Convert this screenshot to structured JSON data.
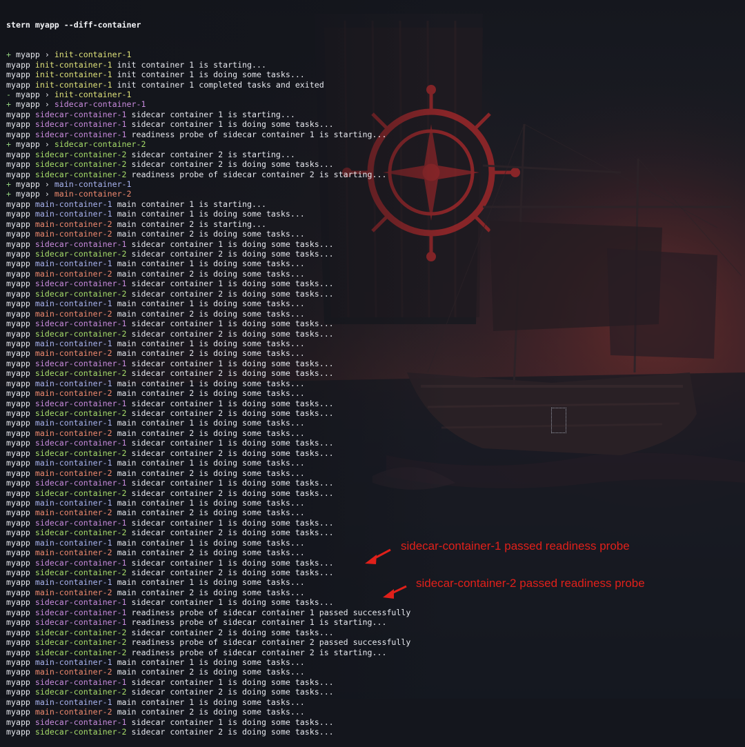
{
  "colors": {
    "prefix_plus": "#92d17d",
    "prefix_minus": "#92d17d",
    "pod": "#e6e8ee",
    "message": "#e6e8ee",
    "annotation": "#e0201a",
    "containers": {
      "init-container-1": "#dfe27a",
      "sidecar-container-1": "#c98bde",
      "sidecar-container-2": "#a7dd6a",
      "main-container-1": "#a9b4f0",
      "main-container-2": "#f08a6f"
    }
  },
  "command": "stern myapp --diff-container",
  "lines": [
    {
      "kind": "event",
      "prefix": "+",
      "pod": "myapp",
      "sep": "›",
      "container": "init-container-1"
    },
    {
      "kind": "log",
      "pod": "myapp",
      "container": "init-container-1",
      "message": "init container 1 is starting..."
    },
    {
      "kind": "log",
      "pod": "myapp",
      "container": "init-container-1",
      "message": "init container 1 is doing some tasks..."
    },
    {
      "kind": "log",
      "pod": "myapp",
      "container": "init-container-1",
      "message": "init container 1 completed tasks and exited"
    },
    {
      "kind": "event",
      "prefix": "-",
      "pod": "myapp",
      "sep": "›",
      "container": "init-container-1"
    },
    {
      "kind": "event",
      "prefix": "+",
      "pod": "myapp",
      "sep": "›",
      "container": "sidecar-container-1"
    },
    {
      "kind": "log",
      "pod": "myapp",
      "container": "sidecar-container-1",
      "message": "sidecar container 1 is starting..."
    },
    {
      "kind": "log",
      "pod": "myapp",
      "container": "sidecar-container-1",
      "message": "sidecar container 1 is doing some tasks..."
    },
    {
      "kind": "log",
      "pod": "myapp",
      "container": "sidecar-container-1",
      "message": "readiness probe of sidecar container 1 is starting..."
    },
    {
      "kind": "event",
      "prefix": "+",
      "pod": "myapp",
      "sep": "›",
      "container": "sidecar-container-2"
    },
    {
      "kind": "log",
      "pod": "myapp",
      "container": "sidecar-container-2",
      "message": "sidecar container 2 is starting..."
    },
    {
      "kind": "log",
      "pod": "myapp",
      "container": "sidecar-container-2",
      "message": "sidecar container 2 is doing some tasks..."
    },
    {
      "kind": "log",
      "pod": "myapp",
      "container": "sidecar-container-2",
      "message": "readiness probe of sidecar container 2 is starting..."
    },
    {
      "kind": "event",
      "prefix": "+",
      "pod": "myapp",
      "sep": "›",
      "container": "main-container-1"
    },
    {
      "kind": "event",
      "prefix": "+",
      "pod": "myapp",
      "sep": "›",
      "container": "main-container-2"
    },
    {
      "kind": "log",
      "pod": "myapp",
      "container": "main-container-1",
      "message": "main container 1 is starting..."
    },
    {
      "kind": "log",
      "pod": "myapp",
      "container": "main-container-1",
      "message": "main container 1 is doing some tasks..."
    },
    {
      "kind": "log",
      "pod": "myapp",
      "container": "main-container-2",
      "message": "main container 2 is starting..."
    },
    {
      "kind": "log",
      "pod": "myapp",
      "container": "main-container-2",
      "message": "main container 2 is doing some tasks..."
    },
    {
      "kind": "log",
      "pod": "myapp",
      "container": "sidecar-container-1",
      "message": "sidecar container 1 is doing some tasks..."
    },
    {
      "kind": "log",
      "pod": "myapp",
      "container": "sidecar-container-2",
      "message": "sidecar container 2 is doing some tasks..."
    },
    {
      "kind": "log",
      "pod": "myapp",
      "container": "main-container-1",
      "message": "main container 1 is doing some tasks..."
    },
    {
      "kind": "log",
      "pod": "myapp",
      "container": "main-container-2",
      "message": "main container 2 is doing some tasks..."
    },
    {
      "kind": "log",
      "pod": "myapp",
      "container": "sidecar-container-1",
      "message": "sidecar container 1 is doing some tasks..."
    },
    {
      "kind": "log",
      "pod": "myapp",
      "container": "sidecar-container-2",
      "message": "sidecar container 2 is doing some tasks..."
    },
    {
      "kind": "log",
      "pod": "myapp",
      "container": "main-container-1",
      "message": "main container 1 is doing some tasks..."
    },
    {
      "kind": "log",
      "pod": "myapp",
      "container": "main-container-2",
      "message": "main container 2 is doing some tasks..."
    },
    {
      "kind": "log",
      "pod": "myapp",
      "container": "sidecar-container-1",
      "message": "sidecar container 1 is doing some tasks..."
    },
    {
      "kind": "log",
      "pod": "myapp",
      "container": "sidecar-container-2",
      "message": "sidecar container 2 is doing some tasks..."
    },
    {
      "kind": "log",
      "pod": "myapp",
      "container": "main-container-1",
      "message": "main container 1 is doing some tasks..."
    },
    {
      "kind": "log",
      "pod": "myapp",
      "container": "main-container-2",
      "message": "main container 2 is doing some tasks..."
    },
    {
      "kind": "log",
      "pod": "myapp",
      "container": "sidecar-container-1",
      "message": "sidecar container 1 is doing some tasks..."
    },
    {
      "kind": "log",
      "pod": "myapp",
      "container": "sidecar-container-2",
      "message": "sidecar container 2 is doing some tasks..."
    },
    {
      "kind": "log",
      "pod": "myapp",
      "container": "main-container-1",
      "message": "main container 1 is doing some tasks..."
    },
    {
      "kind": "log",
      "pod": "myapp",
      "container": "main-container-2",
      "message": "main container 2 is doing some tasks..."
    },
    {
      "kind": "log",
      "pod": "myapp",
      "container": "sidecar-container-1",
      "message": "sidecar container 1 is doing some tasks..."
    },
    {
      "kind": "log",
      "pod": "myapp",
      "container": "sidecar-container-2",
      "message": "sidecar container 2 is doing some tasks..."
    },
    {
      "kind": "log",
      "pod": "myapp",
      "container": "main-container-1",
      "message": "main container 1 is doing some tasks..."
    },
    {
      "kind": "log",
      "pod": "myapp",
      "container": "main-container-2",
      "message": "main container 2 is doing some tasks..."
    },
    {
      "kind": "log",
      "pod": "myapp",
      "container": "sidecar-container-1",
      "message": "sidecar container 1 is doing some tasks..."
    },
    {
      "kind": "log",
      "pod": "myapp",
      "container": "sidecar-container-2",
      "message": "sidecar container 2 is doing some tasks..."
    },
    {
      "kind": "log",
      "pod": "myapp",
      "container": "main-container-1",
      "message": "main container 1 is doing some tasks..."
    },
    {
      "kind": "log",
      "pod": "myapp",
      "container": "main-container-2",
      "message": "main container 2 is doing some tasks..."
    },
    {
      "kind": "log",
      "pod": "myapp",
      "container": "sidecar-container-1",
      "message": "sidecar container 1 is doing some tasks..."
    },
    {
      "kind": "log",
      "pod": "myapp",
      "container": "sidecar-container-2",
      "message": "sidecar container 2 is doing some tasks..."
    },
    {
      "kind": "log",
      "pod": "myapp",
      "container": "main-container-1",
      "message": "main container 1 is doing some tasks..."
    },
    {
      "kind": "log",
      "pod": "myapp",
      "container": "main-container-2",
      "message": "main container 2 is doing some tasks..."
    },
    {
      "kind": "log",
      "pod": "myapp",
      "container": "sidecar-container-1",
      "message": "sidecar container 1 is doing some tasks..."
    },
    {
      "kind": "log",
      "pod": "myapp",
      "container": "sidecar-container-2",
      "message": "sidecar container 2 is doing some tasks..."
    },
    {
      "kind": "log",
      "pod": "myapp",
      "container": "main-container-1",
      "message": "main container 1 is doing some tasks..."
    },
    {
      "kind": "log",
      "pod": "myapp",
      "container": "main-container-2",
      "message": "main container 2 is doing some tasks..."
    },
    {
      "kind": "log",
      "pod": "myapp",
      "container": "sidecar-container-1",
      "message": "sidecar container 1 is doing some tasks..."
    },
    {
      "kind": "log",
      "pod": "myapp",
      "container": "sidecar-container-2",
      "message": "sidecar container 2 is doing some tasks..."
    },
    {
      "kind": "log",
      "pod": "myapp",
      "container": "main-container-1",
      "message": "main container 1 is doing some tasks..."
    },
    {
      "kind": "log",
      "pod": "myapp",
      "container": "main-container-2",
      "message": "main container 2 is doing some tasks..."
    },
    {
      "kind": "log",
      "pod": "myapp",
      "container": "sidecar-container-1",
      "message": "sidecar container 1 is doing some tasks..."
    },
    {
      "kind": "log",
      "pod": "myapp",
      "container": "sidecar-container-1",
      "message": "readiness probe of sidecar container 1 passed successfully"
    },
    {
      "kind": "log",
      "pod": "myapp",
      "container": "sidecar-container-1",
      "message": "readiness probe of sidecar container 1 is starting..."
    },
    {
      "kind": "log",
      "pod": "myapp",
      "container": "sidecar-container-2",
      "message": "sidecar container 2 is doing some tasks..."
    },
    {
      "kind": "log",
      "pod": "myapp",
      "container": "sidecar-container-2",
      "message": "readiness probe of sidecar container 2 passed successfully"
    },
    {
      "kind": "log",
      "pod": "myapp",
      "container": "sidecar-container-2",
      "message": "readiness probe of sidecar container 2 is starting..."
    },
    {
      "kind": "log",
      "pod": "myapp",
      "container": "main-container-1",
      "message": "main container 1 is doing some tasks..."
    },
    {
      "kind": "log",
      "pod": "myapp",
      "container": "main-container-2",
      "message": "main container 2 is doing some tasks..."
    },
    {
      "kind": "log",
      "pod": "myapp",
      "container": "sidecar-container-1",
      "message": "sidecar container 1 is doing some tasks..."
    },
    {
      "kind": "log",
      "pod": "myapp",
      "container": "sidecar-container-2",
      "message": "sidecar container 2 is doing some tasks..."
    },
    {
      "kind": "log",
      "pod": "myapp",
      "container": "main-container-1",
      "message": "main container 1 is doing some tasks..."
    },
    {
      "kind": "log",
      "pod": "myapp",
      "container": "main-container-2",
      "message": "main container 2 is doing some tasks..."
    },
    {
      "kind": "log",
      "pod": "myapp",
      "container": "sidecar-container-1",
      "message": "sidecar container 1 is doing some tasks..."
    },
    {
      "kind": "log",
      "pod": "myapp",
      "container": "sidecar-container-2",
      "message": "sidecar container 2 is doing some tasks..."
    }
  ],
  "annotations": {
    "sidecar1": "sidecar-container-1 passed readiness probe",
    "sidecar2": "sidecar-container-2 passed readiness probe"
  }
}
